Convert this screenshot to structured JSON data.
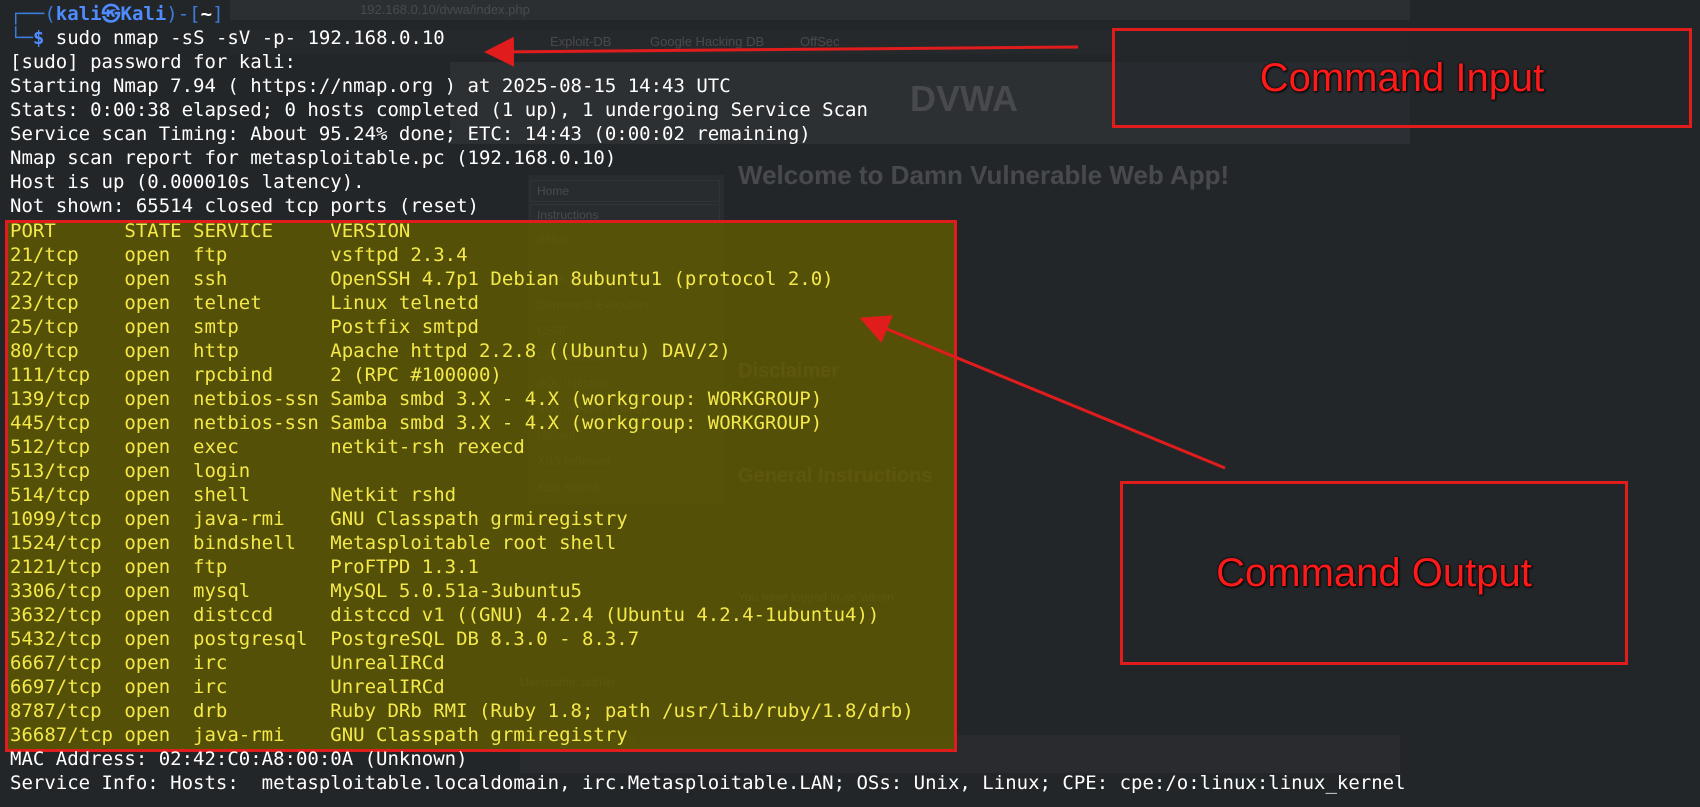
{
  "background_browser": {
    "url": "192.168.0.10/dvwa/index.php",
    "bookmarks": [
      "Exploit-DB",
      "Google Hacking DB",
      "OffSec"
    ],
    "logo": "DVWA",
    "heading": "Welcome to Damn Vulnerable Web App!",
    "menu": [
      "Home",
      "Instructions",
      "Setup",
      "Brute Force",
      "Command Execution",
      "CSRF",
      "File Inclusion",
      "SQL Injection",
      "SQL Injection (Blind)",
      "Upload",
      "XSS reflected",
      "XSS stored"
    ],
    "section_disclaimer": "Disclaimer",
    "section_general": "General Instructions",
    "logged_in": "You have logged in as 'admin'",
    "username_label": "Username: admin"
  },
  "terminal": {
    "prompt_prefix": "┌──(",
    "prompt_user": "kali㉿Kali",
    "prompt_mid": ")-[",
    "prompt_dir": "~",
    "prompt_suffix": "]",
    "prompt_line2": "└─",
    "dollar": "$",
    "command": "sudo nmap -sS -sV -p- 192.168.0.10",
    "pre_output": [
      "[sudo] password for kali:",
      "Starting Nmap 7.94 ( https://nmap.org ) at 2025-08-15 14:43 UTC",
      "Stats: 0:00:38 elapsed; 0 hosts completed (1 up), 1 undergoing Service Scan",
      "Service scan Timing: About 95.24% done; ETC: 14:43 (0:00:02 remaining)",
      "Nmap scan report for metasploitable.pc (192.168.0.10)",
      "Host is up (0.000010s latency).",
      "Not shown: 65514 closed tcp ports (reset)"
    ],
    "port_table_header": "PORT      STATE SERVICE     VERSION",
    "ports": [
      "21/tcp    open  ftp         vsftpd 2.3.4",
      "22/tcp    open  ssh         OpenSSH 4.7p1 Debian 8ubuntu1 (protocol 2.0)",
      "23/tcp    open  telnet      Linux telnetd",
      "25/tcp    open  smtp        Postfix smtpd",
      "80/tcp    open  http        Apache httpd 2.2.8 ((Ubuntu) DAV/2)",
      "111/tcp   open  rpcbind     2 (RPC #100000)",
      "139/tcp   open  netbios-ssn Samba smbd 3.X - 4.X (workgroup: WORKGROUP)",
      "445/tcp   open  netbios-ssn Samba smbd 3.X - 4.X (workgroup: WORKGROUP)",
      "512/tcp   open  exec        netkit-rsh rexecd",
      "513/tcp   open  login",
      "514/tcp   open  shell       Netkit rshd",
      "1099/tcp  open  java-rmi    GNU Classpath grmiregistry",
      "1524/tcp  open  bindshell   Metasploitable root shell",
      "2121/tcp  open  ftp         ProFTPD 1.3.1",
      "3306/tcp  open  mysql       MySQL 5.0.51a-3ubuntu5",
      "3632/tcp  open  distccd     distccd v1 ((GNU) 4.2.4 (Ubuntu 4.2.4-1ubuntu4))",
      "5432/tcp  open  postgresql  PostgreSQL DB 8.3.0 - 8.3.7",
      "6667/tcp  open  irc         UnrealIRCd",
      "6697/tcp  open  irc         UnrealIRCd",
      "8787/tcp  open  drb         Ruby DRb RMI (Ruby 1.8; path /usr/lib/ruby/1.8/drb)",
      "36687/tcp open  java-rmi    GNU Classpath grmiregistry"
    ],
    "post_output": [
      "MAC Address: 02:42:C0:A8:00:0A (Unknown)",
      "Service Info: Hosts:  metasploitable.localdomain, irc.Metasploitable.LAN; OSs: Unix, Linux; CPE: cpe:/o:linux:linux_kernel"
    ]
  },
  "annotations": {
    "command_input": "Command Input",
    "command_output": "Command Output",
    "color": "#e01c1c"
  }
}
